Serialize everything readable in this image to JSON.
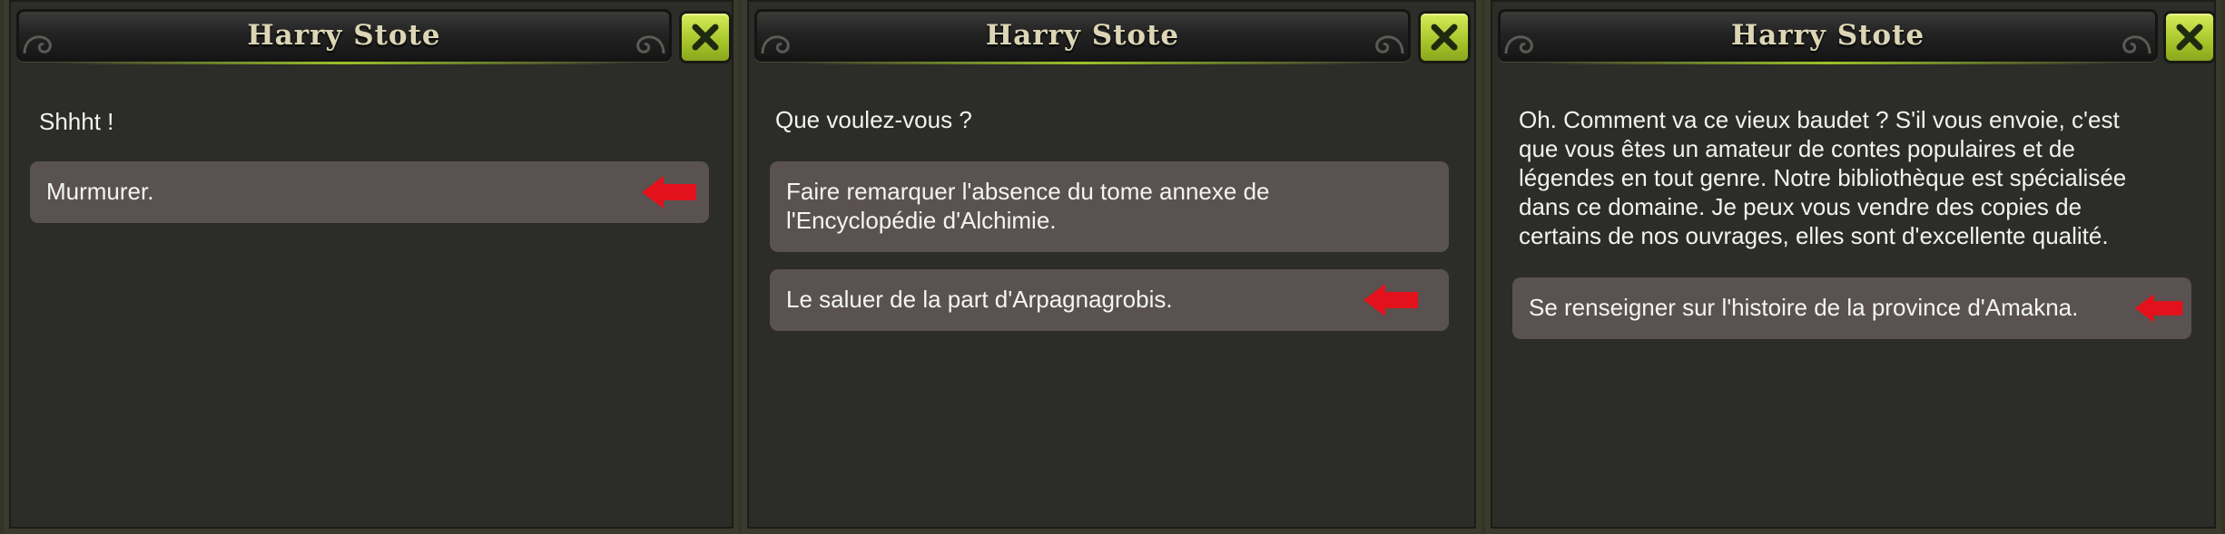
{
  "panels": [
    {
      "title": "Harry Stote",
      "message_lines": [
        "Shhht !"
      ],
      "options": [
        {
          "lines": [
            "Murmurer."
          ],
          "highlighted": true
        }
      ]
    },
    {
      "title": "Harry Stote",
      "message_lines": [
        "Que voulez-vous ?"
      ],
      "options": [
        {
          "lines": [
            "Faire remarquer l'absence du tome annexe de",
            "l'Encyclopédie d'Alchimie."
          ],
          "highlighted": false
        },
        {
          "lines": [
            "Le saluer de la part d'Arpagnagrobis."
          ],
          "highlighted": true
        }
      ]
    },
    {
      "title": "Harry Stote",
      "message_lines": [
        "Oh. Comment va ce vieux baudet ? S'il vous envoie, c'est",
        "que vous êtes un amateur de contes populaires et de",
        "légendes en tout genre. Notre bibliothèque est spécialisée",
        "dans ce domaine. Je peux vous vendre des copies de",
        "certains de nos ouvrages, elles sont d'excellente qualité."
      ],
      "options": [
        {
          "lines": [
            "Se renseigner sur l'histoire de la province d'Amakna."
          ],
          "highlighted": true
        }
      ]
    }
  ],
  "icons": {
    "close": "close-x-icon",
    "pointer": "red-arrow-left-icon",
    "ornament": "swirl-ornament-icon"
  },
  "colors": {
    "close_button": "#a7c42a",
    "option_background": "#5a5250",
    "arrow": "#e2111b",
    "panel_background": "#2c2c28"
  }
}
